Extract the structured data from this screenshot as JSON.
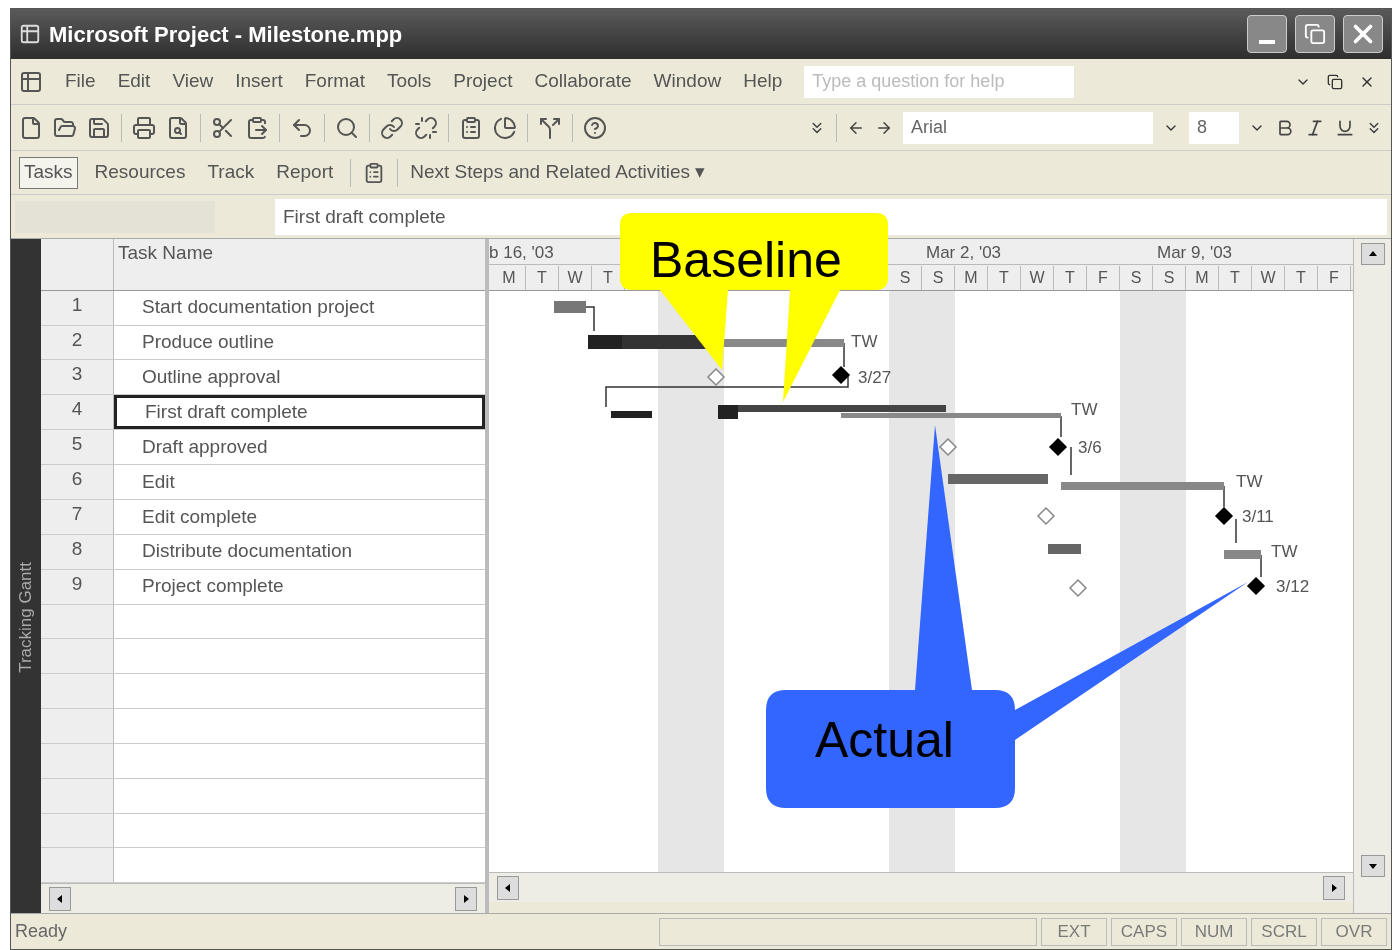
{
  "window": {
    "title": "Microsoft Project - Milestone.mpp"
  },
  "menu": [
    "File",
    "Edit",
    "View",
    "Insert",
    "Format",
    "Tools",
    "Project",
    "Collaborate",
    "Window",
    "Help"
  ],
  "help_box": {
    "placeholder": "Type a question for help"
  },
  "formatting": {
    "font": "Arial",
    "size": "8"
  },
  "view_bar": {
    "tabs": [
      {
        "label": "Tasks",
        "selected": true
      },
      {
        "label": "Resources",
        "selected": false
      },
      {
        "label": "Track",
        "selected": false
      },
      {
        "label": "Report",
        "selected": false
      }
    ],
    "guide": "Next Steps and Related Activities ▾"
  },
  "entry_bar": {
    "value": "First draft complete"
  },
  "view_label": "Tracking Gantt",
  "table": {
    "columns": [
      "Task Name"
    ],
    "rows": [
      {
        "id": "1",
        "name": "Start documentation project",
        "kind": "task",
        "selected": false
      },
      {
        "id": "2",
        "name": "Produce outline",
        "kind": "task",
        "label": "TW",
        "selected": false
      },
      {
        "id": "3",
        "name": "Outline approval",
        "kind": "milestone",
        "label": "3/27",
        "selected": false
      },
      {
        "id": "4",
        "name": "First draft complete",
        "kind": "task",
        "label": "TW",
        "selected": true
      },
      {
        "id": "5",
        "name": "Draft approved",
        "kind": "milestone",
        "label": "3/6",
        "selected": false
      },
      {
        "id": "6",
        "name": "Edit",
        "kind": "task",
        "label": "TW",
        "selected": false
      },
      {
        "id": "7",
        "name": "Edit complete",
        "kind": "milestone",
        "label": "3/11",
        "selected": false
      },
      {
        "id": "8",
        "name": "Distribute documentation",
        "kind": "task",
        "label": "TW",
        "selected": false
      },
      {
        "id": "9",
        "name": "Project complete",
        "kind": "milestone",
        "label": "3/12",
        "selected": false
      }
    ]
  },
  "timeline": {
    "weeks": [
      "b 16, '03",
      "Mar 2, '03",
      "Mar 9, '03"
    ],
    "days_first": [
      "M",
      "T",
      "W",
      "T"
    ],
    "days_last": [
      "S",
      "S",
      "M",
      "T",
      "W",
      "T",
      "F",
      "S",
      "S",
      "M",
      "T",
      "W",
      "T",
      "F"
    ]
  },
  "callouts": [
    {
      "kind": "baseline",
      "text": "Baseline"
    },
    {
      "kind": "actual",
      "text": "Actual"
    }
  ],
  "status_bar": {
    "text": "Ready",
    "indicators": [
      {
        "label": "EXT",
        "on": false
      },
      {
        "label": "CAPS",
        "on": false
      },
      {
        "label": "NUM",
        "on": false
      },
      {
        "label": "SCRL",
        "on": false
      },
      {
        "label": "OVR",
        "on": false
      }
    ]
  }
}
